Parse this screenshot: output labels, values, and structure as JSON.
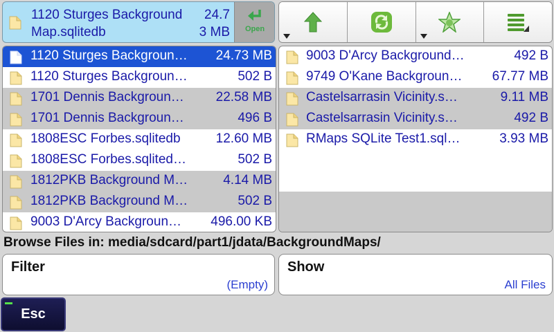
{
  "selected_file": {
    "name_line1": "1120 Sturges Background",
    "name_line2": "Map.sqlitedb",
    "size_line1": "24.7",
    "size_line2": "3 MB",
    "open_label": "Open",
    "icons": {
      "file": "file-icon",
      "open": "enter-arrow-icon"
    }
  },
  "toolbar": {
    "buttons": [
      {
        "name": "up-arrow-icon",
        "has_dropdown": true
      },
      {
        "name": "refresh-icon",
        "has_dropdown": false
      },
      {
        "name": "star-icon",
        "has_dropdown": true
      },
      {
        "name": "list-menu-icon",
        "has_dropdown": false
      }
    ]
  },
  "left_list": [
    {
      "name": "1120 Sturges Backgroun…",
      "size": "24.73 MB",
      "selected": true,
      "shaded": false
    },
    {
      "name": "1120 Sturges Backgroun…",
      "size": "502 B",
      "selected": false,
      "shaded": false
    },
    {
      "name": "1701 Dennis Backgroun…",
      "size": "22.58 MB",
      "selected": false,
      "shaded": true
    },
    {
      "name": "1701 Dennis Backgroun…",
      "size": "496 B",
      "selected": false,
      "shaded": true
    },
    {
      "name": "1808ESC Forbes.sqlitedb",
      "size": "12.60 MB",
      "selected": false,
      "shaded": false
    },
    {
      "name": "1808ESC Forbes.sqlited…",
      "size": "502 B",
      "selected": false,
      "shaded": false
    },
    {
      "name": "1812PKB Background M…",
      "size": "4.14 MB",
      "selected": false,
      "shaded": true
    },
    {
      "name": "1812PKB Background M…",
      "size": "502 B",
      "selected": false,
      "shaded": true
    },
    {
      "name": "9003 D'Arcy Backgroun…",
      "size": "496.00 KB",
      "selected": false,
      "shaded": false
    }
  ],
  "right_list": [
    {
      "name": "9003 D'Arcy Background…",
      "size": "492 B",
      "shaded": false
    },
    {
      "name": "9749 O'Kane Backgroun…",
      "size": "67.77 MB",
      "shaded": false
    },
    {
      "name": "Castelsarrasin Vicinity.s…",
      "size": "9.11 MB",
      "shaded": true
    },
    {
      "name": "Castelsarrasin Vicinity.s…",
      "size": "492 B",
      "shaded": true
    },
    {
      "name": "RMaps SQLite Test1.sql…",
      "size": "3.93 MB",
      "shaded": false
    }
  ],
  "right_list_filler_shading": [
    false,
    false,
    true,
    true
  ],
  "browse_path": "Browse Files in: media/sdcard/part1/jdata/BackgroundMaps/",
  "filter": {
    "title": "Filter",
    "value": "(Empty)"
  },
  "show": {
    "title": "Show",
    "value": "All Files"
  },
  "esc_label": "Esc",
  "colors": {
    "background": "#d6d6d6",
    "selected_header": "#aee0f6",
    "selected_row": "#1d54d4",
    "link_text": "#1a1aa8",
    "shaded_row": "#c9c9c9",
    "open_button": "#a9a9a9",
    "esc_button": "#16163f",
    "esc_indicator": "#55e04a"
  }
}
